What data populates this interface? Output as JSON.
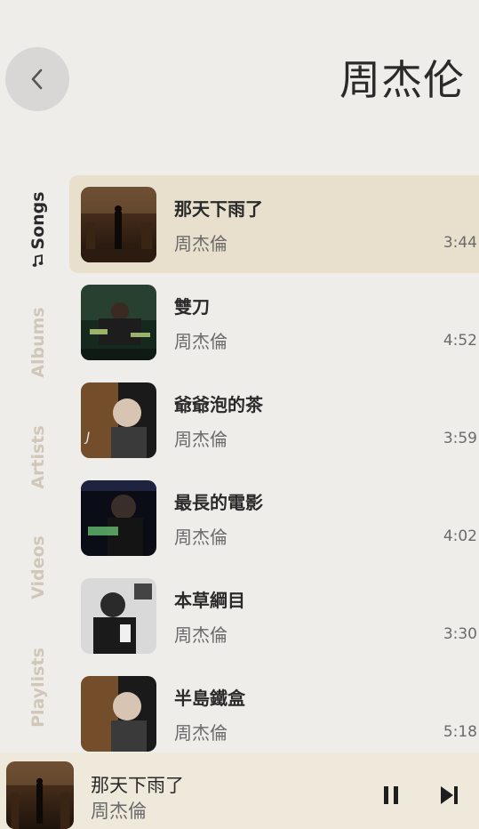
{
  "header": {
    "title": "周杰伦"
  },
  "nav": {
    "tabs": [
      {
        "label": "Songs",
        "active": true,
        "icon": "music-note-icon"
      },
      {
        "label": "Albums",
        "active": false
      },
      {
        "label": "Artists",
        "active": false
      },
      {
        "label": "Videos",
        "active": false
      },
      {
        "label": "Playlists",
        "active": false
      }
    ]
  },
  "songs": [
    {
      "title": "那天下雨了",
      "artist": "周杰倫",
      "duration": "3:44",
      "active": true
    },
    {
      "title": "雙刀",
      "artist": "周杰倫",
      "duration": "4:52"
    },
    {
      "title": "爺爺泡的茶",
      "artist": "周杰倫",
      "duration": "3:59"
    },
    {
      "title": "最長的電影",
      "artist": "周杰倫",
      "duration": "4:02"
    },
    {
      "title": "本草綱目",
      "artist": "周杰倫",
      "duration": "3:30"
    },
    {
      "title": "半島鐵盒",
      "artist": "周杰倫",
      "duration": "5:18"
    }
  ],
  "player": {
    "title": "那天下雨了",
    "artist": "周杰倫",
    "state": "playing"
  },
  "colors": {
    "background": "#efedea",
    "active_row": "#e8e0cc",
    "player_bar": "#efe9dc",
    "inactive_tab": "#cfc7b8",
    "text_primary": "#2a2a2a",
    "text_secondary": "#6b6b6b"
  }
}
